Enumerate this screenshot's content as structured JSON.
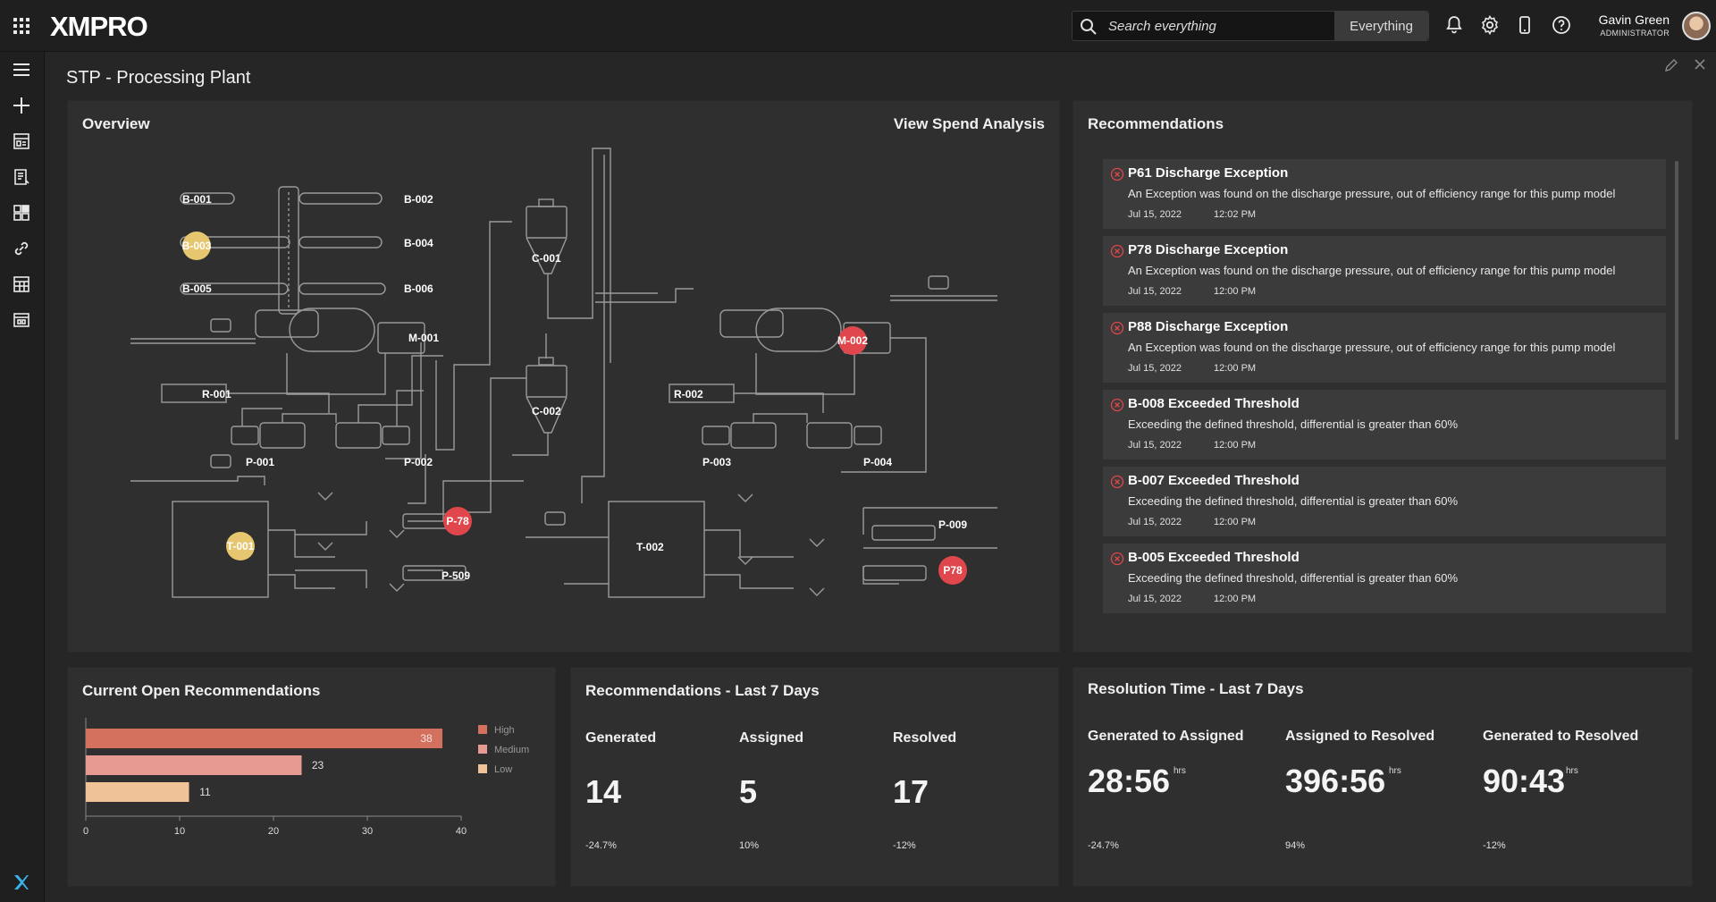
{
  "header": {
    "logo_text": "XMPRO",
    "search_placeholder": "Search everything",
    "search_scope": "Everything",
    "user_name": "Gavin Green",
    "user_role": "ADMINISTRATOR"
  },
  "page": {
    "title": "STP - Processing Plant"
  },
  "overview": {
    "title": "Overview",
    "link": "View Spend Analysis",
    "labels": {
      "b001": "B-001",
      "b002": "B-002",
      "b003": "B-003",
      "b004": "B-004",
      "b005": "B-005",
      "b006": "B-006",
      "c001": "C-001",
      "c002": "C-002",
      "m001": "M-001",
      "m002": "M-002",
      "r001": "R-001",
      "r002": "R-002",
      "p001": "P-001",
      "p002": "P-002",
      "p003": "P-003",
      "p004": "P-004",
      "p78a": "P-78",
      "p509": "P-509",
      "p009": "P-009",
      "p78b": "P78",
      "t001": "T-001",
      "t002": "T-002"
    },
    "status_colors": {
      "warning": "#e6c66e",
      "alarm": "#e0474c"
    }
  },
  "recommendations": {
    "title": "Recommendations",
    "items": [
      {
        "title": "P61 Discharge Exception",
        "description": "An Exception was found on the discharge pressure, out of efficiency range for this pump model",
        "date": "Jul 15, 2022",
        "time": "12:02 PM"
      },
      {
        "title": "P78 Discharge Exception",
        "description": "An Exception was found on the discharge pressure, out of efficiency range for this pump model",
        "date": "Jul 15, 2022",
        "time": "12:00 PM"
      },
      {
        "title": "P88 Discharge Exception",
        "description": "An Exception was found on the discharge pressure, out of efficiency range for this pump model",
        "date": "Jul 15, 2022",
        "time": "12:00 PM"
      },
      {
        "title": "B-008 Exceeded Threshold",
        "description": "Exceeding the defined threshold, differential is greater than 60%",
        "date": "Jul 15, 2022",
        "time": "12:00 PM"
      },
      {
        "title": "B-007 Exceeded Threshold",
        "description": "Exceeding the defined threshold, differential is greater than 60%",
        "date": "Jul 15, 2022",
        "time": "12:00 PM"
      },
      {
        "title": "B-005 Exceeded Threshold",
        "description": "Exceeding the defined threshold, differential is greater than 60%",
        "date": "Jul 15, 2022",
        "time": "12:00 PM"
      }
    ]
  },
  "open_recs": {
    "title": "Current Open Recommendations"
  },
  "chart_data": {
    "type": "bar",
    "orientation": "horizontal",
    "categories": [
      "High",
      "Medium",
      "Low"
    ],
    "values": [
      38,
      23,
      11
    ],
    "colors": [
      "#d4705e",
      "#e79a92",
      "#efc297"
    ],
    "xlim": [
      0,
      40
    ],
    "xticks": [
      "0",
      "10",
      "20",
      "30",
      "40"
    ],
    "legend_position": "right",
    "grid": false
  },
  "last7": {
    "title": "Recommendations - Last 7 Days",
    "metrics": [
      {
        "label": "Generated",
        "value": "14",
        "change": "-24.7%"
      },
      {
        "label": "Assigned",
        "value": "5",
        "change": "10%"
      },
      {
        "label": "Resolved",
        "value": "17",
        "change": "-12%"
      }
    ]
  },
  "resolution": {
    "title": "Resolution Time - Last 7 Days",
    "metrics": [
      {
        "label": "Generated to Assigned",
        "value": "28:56",
        "unit": "hrs",
        "change": "-24.7%"
      },
      {
        "label": "Assigned to Resolved",
        "value": "396:56",
        "unit": "hrs",
        "change": "94%"
      },
      {
        "label": "Generated to Resolved",
        "value": "90:43",
        "unit": "hrs",
        "change": "-12%"
      }
    ]
  },
  "icons": {
    "apps": "grid-icon",
    "search": "search-icon",
    "notifications": "bell-icon",
    "settings": "gear-icon",
    "device": "mobile-icon",
    "help": "help-icon",
    "edit": "pencil-icon",
    "close": "close-icon"
  }
}
